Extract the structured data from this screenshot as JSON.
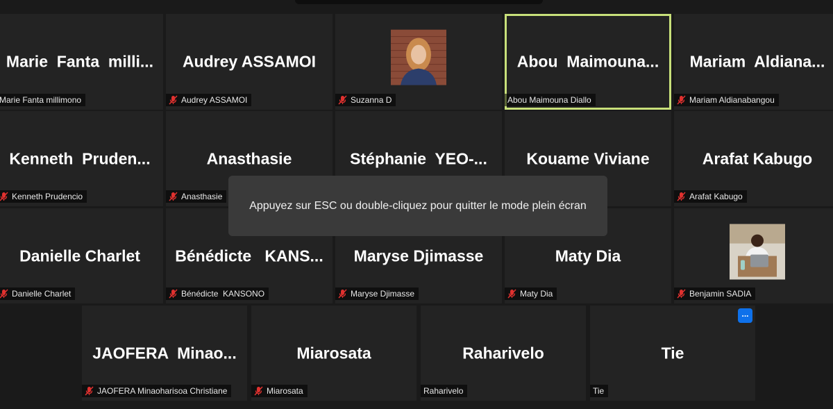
{
  "participants": [
    {
      "tile_name": "Marie  Fanta  milli...",
      "label": "Marie Fanta millimono",
      "muted": false,
      "active": false,
      "photo": null
    },
    {
      "tile_name": "Audrey ASSAMOI",
      "label": "Audrey ASSAMOI",
      "muted": true,
      "active": false,
      "photo": null
    },
    {
      "tile_name": "",
      "label": "Suzanna D",
      "muted": true,
      "active": false,
      "photo": "woman-portrait"
    },
    {
      "tile_name": "Abou  Maimouna...",
      "label": "Abou Maimouna Diallo",
      "muted": false,
      "active": true,
      "photo": null
    },
    {
      "tile_name": "Mariam  Aldiana...",
      "label": "Mariam Aldianabangou",
      "muted": true,
      "active": false,
      "photo": null
    },
    {
      "tile_name": "Kenneth  Pruden...",
      "label": "Kenneth Prudencio",
      "muted": true,
      "active": false,
      "photo": null
    },
    {
      "tile_name": "Anasthasie",
      "label": "Anasthasie",
      "muted": true,
      "active": false,
      "photo": null
    },
    {
      "tile_name": "Stéphanie  YEO-...",
      "label": "",
      "muted": false,
      "active": false,
      "photo": null
    },
    {
      "tile_name": "Kouame Viviane",
      "label": "",
      "muted": false,
      "active": false,
      "photo": null
    },
    {
      "tile_name": "Arafat Kabugo",
      "label": "Arafat Kabugo",
      "muted": true,
      "active": false,
      "photo": null
    },
    {
      "tile_name": "Danielle Charlet",
      "label": "Danielle Charlet",
      "muted": true,
      "active": false,
      "photo": null
    },
    {
      "tile_name": "Bénédicte   KANS...",
      "label": "Bénédicte  KANSONO",
      "muted": true,
      "active": false,
      "photo": null
    },
    {
      "tile_name": "Maryse Djimasse",
      "label": "Maryse Djimasse",
      "muted": true,
      "active": false,
      "photo": null
    },
    {
      "tile_name": "Maty Dia",
      "label": "Maty Dia",
      "muted": true,
      "active": false,
      "photo": null
    },
    {
      "tile_name": "",
      "label": "Benjamin SADIA",
      "muted": true,
      "active": false,
      "photo": "man-at-laptop"
    },
    {
      "tile_name": "JAOFERA  Minao...",
      "label": "JAOFERA Minaoharisoa Christiane",
      "muted": true,
      "active": false,
      "photo": null
    },
    {
      "tile_name": "Miarosata",
      "label": "Miarosata",
      "muted": true,
      "active": false,
      "photo": null
    },
    {
      "tile_name": "Raharivelo",
      "label": "Raharivelo",
      "muted": false,
      "active": false,
      "photo": null
    },
    {
      "tile_name": "Tie",
      "label": "Tie",
      "muted": false,
      "active": false,
      "photo": null,
      "more_button": "..."
    }
  ],
  "fullscreen_notice": "Appuyez sur ESC ou double-cliquez pour quitter le mode plein écran",
  "colors": {
    "active_speaker": "#c8e07a",
    "muted_icon": "#e0312f",
    "more_button": "#0e71eb"
  }
}
